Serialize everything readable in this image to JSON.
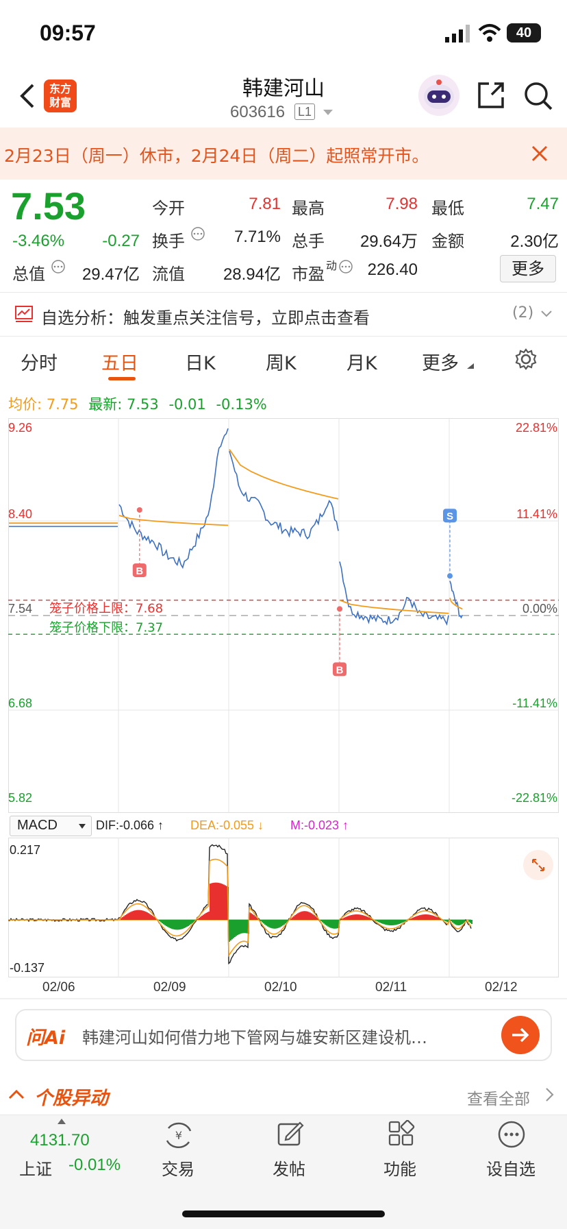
{
  "status": {
    "time": "09:57",
    "battery": "40"
  },
  "header": {
    "title": "韩建河山",
    "code": "603616",
    "level": "L1",
    "logo_line1": "东方",
    "logo_line2": "财富"
  },
  "notice": {
    "text": "2月23日（周一）休市，2月24日（周二）起照常开市。"
  },
  "quote": {
    "price": "7.53",
    "change_pct": "-3.46%",
    "change": "-0.27",
    "open_label": "今开",
    "open": "7.81",
    "high_label": "最高",
    "high": "7.98",
    "low_label": "最低",
    "low": "7.47",
    "turnover_label": "换手",
    "turnover": "7.71%",
    "volume_label": "总手",
    "volume": "29.64万",
    "amount_label": "金额",
    "amount": "2.30亿",
    "mktcap_label": "总值",
    "mktcap": "29.47亿",
    "float_label": "流值",
    "float": "28.94亿",
    "pe_label": "市盈",
    "pe_sup": "动",
    "pe": "226.40",
    "more": "更多"
  },
  "analysis": {
    "text": "自选分析：触发重点关注信号，立即点击查看",
    "count": "(2)"
  },
  "tabs": [
    {
      "label": "分时"
    },
    {
      "label": "五日"
    },
    {
      "label": "日K"
    },
    {
      "label": "周K"
    },
    {
      "label": "月K"
    },
    {
      "label": "更多"
    }
  ],
  "chart_info": {
    "avg_label": "均价:",
    "avg": "7.75",
    "last_label": "最新:",
    "last": "7.53",
    "chg": "-0.01",
    "chg_pct": "-0.13%"
  },
  "chart_data": {
    "type": "line",
    "y_left_ticks": [
      "9.26",
      "8.40",
      "7.54",
      "6.68",
      "5.82"
    ],
    "y_right_ticks": [
      "22.81%",
      "11.41%",
      "0.00%",
      "-11.41%",
      "-22.81%"
    ],
    "x_ticks": [
      "02/06",
      "02/09",
      "02/10",
      "02/11",
      "02/12"
    ],
    "cage_upper": "笼子价格上限：7.68",
    "cage_lower": "笼子价格下限：7.37",
    "markers": [
      "B",
      "B",
      "S"
    ],
    "price_series_by_day": [
      [
        8.35,
        8.35,
        8.35,
        8.35,
        8.35,
        8.35,
        8.35,
        8.35
      ],
      [
        8.55,
        8.4,
        8.3,
        8.25,
        8.2,
        8.1,
        8.05,
        8.0,
        8.15,
        8.3,
        8.5,
        9.1,
        9.2
      ],
      [
        9.05,
        8.7,
        8.6,
        8.55,
        8.4,
        8.35,
        8.3,
        8.3,
        8.28,
        8.4,
        8.6,
        8.35
      ],
      [
        8.05,
        7.6,
        7.55,
        7.52,
        7.5,
        7.5,
        7.55,
        7.7,
        7.55,
        7.52,
        7.5,
        7.5
      ],
      [
        7.85,
        7.7,
        7.6,
        7.5
      ]
    ],
    "avg_series_by_day": [
      [
        8.38,
        8.38
      ],
      [
        8.45,
        8.36
      ],
      [
        9.05,
        8.6
      ],
      [
        7.68,
        7.56
      ],
      [
        7.7,
        7.6
      ]
    ]
  },
  "macd": {
    "selector": "MACD",
    "dif": "DIF:-0.066 ↑",
    "dea": "DEA:-0.055 ↓",
    "m": "M:-0.023 ↑",
    "ymax": "0.217",
    "ymin": "-0.137"
  },
  "ai": {
    "brand": "问Ai",
    "placeholder": "韩建河山如何借力地下管网与雄安新区建设机…"
  },
  "hot": {
    "title": "个股异动",
    "more": "查看全部"
  },
  "bottom_nav": {
    "index_value": "4131.70",
    "index_name": "上证",
    "index_change": "-0.01%",
    "items": [
      {
        "label": "交易"
      },
      {
        "label": "发帖"
      },
      {
        "label": "功能"
      },
      {
        "label": "设自选"
      }
    ]
  },
  "colors": {
    "accent": "#e8530f",
    "up": "#e8312f",
    "down": "#1aa12d",
    "price_line": "#3a6fc4",
    "avg_line": "#f39b1b"
  }
}
